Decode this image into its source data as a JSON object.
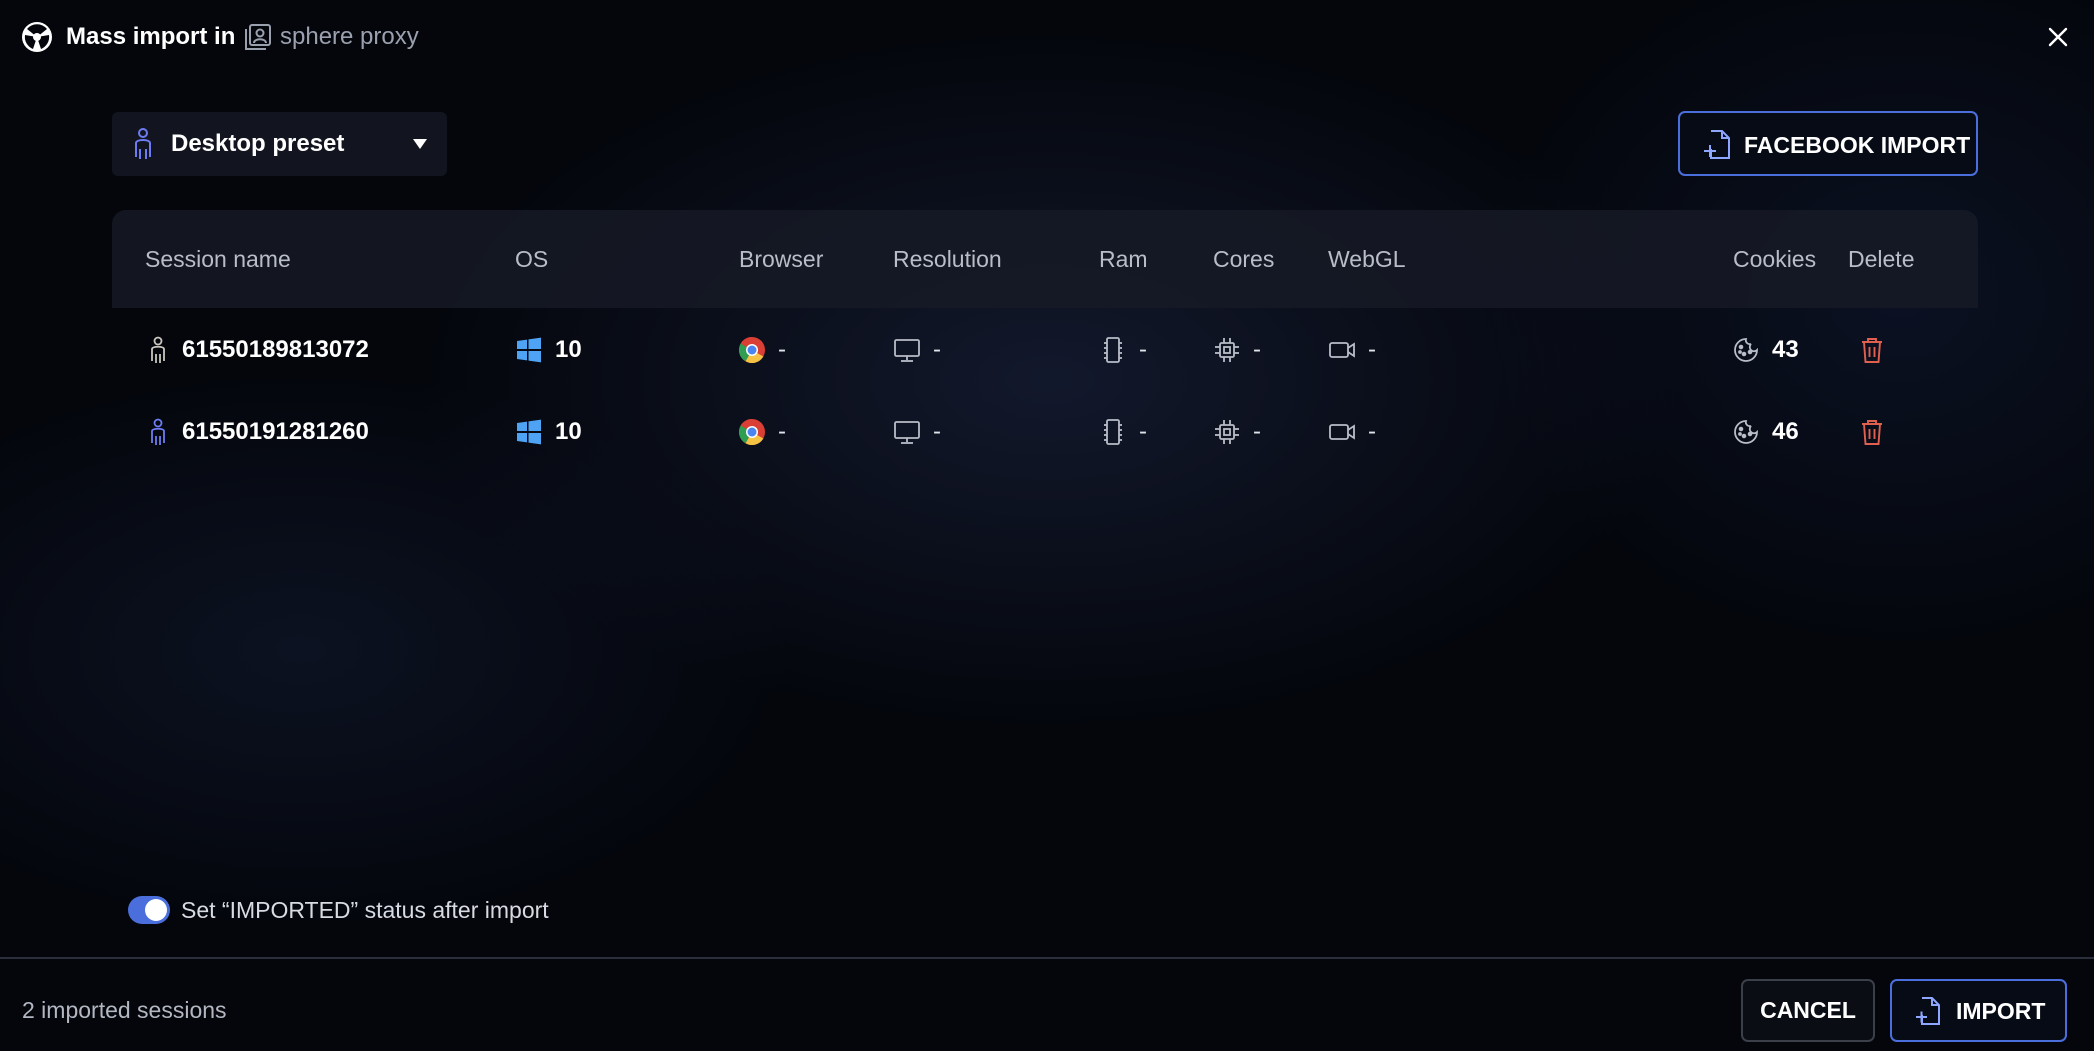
{
  "title": {
    "main": "Mass import in",
    "group": "sphere proxy"
  },
  "preset": {
    "label": "Desktop preset"
  },
  "toolbar": {
    "facebook_import_label": "FACEBOOK IMPORT"
  },
  "table": {
    "columns": [
      "Session name",
      "OS",
      "Browser",
      "Resolution",
      "Ram",
      "Cores",
      "WebGL",
      "Cookies",
      "Delete"
    ],
    "rows": [
      {
        "session_name": "61550189813072",
        "os": "10",
        "browser": "-",
        "resolution": "-",
        "ram": "-",
        "cores": "-",
        "webgl": "-",
        "cookies": "43",
        "person_color": "#c9c6bd"
      },
      {
        "session_name": "61550191281260",
        "os": "10",
        "browser": "-",
        "resolution": "-",
        "ram": "-",
        "cores": "-",
        "webgl": "-",
        "cookies": "46",
        "person_color": "#6d7cf2"
      }
    ]
  },
  "options": {
    "imported_status_label": "Set “IMPORTED” status after import",
    "imported_status_on": true
  },
  "footer": {
    "count_label": "2 imported sessions",
    "cancel_label": "CANCEL",
    "import_label": "IMPORT"
  },
  "colors": {
    "accent": "#4a6fdc",
    "delete": "#e0604f",
    "windows": "#4fa3f5"
  },
  "icons": {
    "app": "app-logo-icon",
    "group": "proxy-group-icon",
    "close": "close-icon",
    "preset": "person-icon",
    "caret": "caret-down-icon",
    "facebook_import": "file-add-icon",
    "os": "windows-icon",
    "browser": "chrome-icon",
    "resolution": "monitor-icon",
    "ram": "ram-icon",
    "cores": "cpu-icon",
    "webgl": "camera-icon",
    "cookies": "cookie-icon",
    "delete": "trash-icon"
  }
}
